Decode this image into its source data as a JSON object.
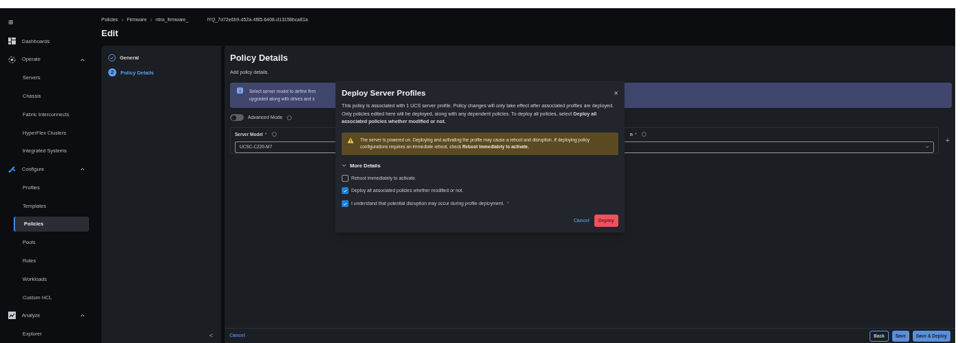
{
  "sidebar": {
    "menu_icon": "≡",
    "items": [
      {
        "kind": "link",
        "label": "Dashboards"
      },
      {
        "kind": "section",
        "label": "Operate",
        "expanded": true,
        "children": [
          {
            "label": "Servers",
            "selected": false
          },
          {
            "label": "Chassis",
            "selected": false
          },
          {
            "label": "Fabric Interconnects",
            "selected": false
          },
          {
            "label": "HyperFlex Clusters",
            "selected": false
          },
          {
            "label": "Integrated Systems",
            "selected": false
          }
        ]
      },
      {
        "kind": "section",
        "label": "Configure",
        "expanded": true,
        "children": [
          {
            "label": "Profiles",
            "selected": false
          },
          {
            "label": "Templates",
            "selected": false
          },
          {
            "label": "Policies",
            "selected": true
          },
          {
            "label": "Pools",
            "selected": false
          },
          {
            "label": "Rules",
            "selected": false
          },
          {
            "label": "Workloads",
            "selected": false
          },
          {
            "label": "Custom HCL",
            "selected": false
          }
        ]
      },
      {
        "kind": "section",
        "label": "Analyze",
        "expanded": true,
        "children": [
          {
            "label": "Explorer",
            "selected": false
          }
        ]
      }
    ]
  },
  "header": {
    "breadcrumbs": [
      "Policies",
      "Firmware",
      "ntnx_firmware_"
    ],
    "separators": [
      "›",
      "›"
    ],
    "id_text": "IYQ_7d72e6b9-d52a-4f85-6408-d13158bca81a",
    "title": "Edit"
  },
  "steps": [
    {
      "label": "General",
      "done": true,
      "selected": false
    },
    {
      "label": "Policy Details",
      "number": "2",
      "done": false,
      "selected": true
    }
  ],
  "collapse": "<",
  "content": {
    "title": "Policy Details",
    "subtitle": "Add policy details.",
    "info_lines": [
      "Select server model to define firm",
      "upgraded along with drives and s"
    ],
    "advanced_mode": {
      "label": "Advanced Mode",
      "on": false
    },
    "server_model": {
      "label": "Server Model",
      "required_mark": "*",
      "value": "UCSC-C220-M7"
    },
    "second_field": {
      "label": "n",
      "required_mark": "*"
    },
    "add": "+"
  },
  "modal": {
    "title": "Deploy Server Profiles",
    "close": "×",
    "body": "This policy is associated with 1 UCS server profile. Policy changes will only take effect after associated profiles are deployed. Only policies edited here will be deployed, along with any dependent policies. To deploy all policies, select **Deploy all associated policies whether modified or not.**",
    "warning": "The server is powered on. Deploying and activating the profile may cause a reboot and disruption. If deploying policy configurations requires an immediate reboot, check **Reboot immediately to activate.**",
    "details": {
      "label": "More Details",
      "expanded": true
    },
    "options": [
      {
        "label": "Reboot immediately to activate.",
        "checked": false
      },
      {
        "label": "Deploy all associated policies whether modified or not.",
        "checked": true
      },
      {
        "label": "I understand that potential disruption may occur during profile deployment.",
        "checked": true,
        "required_mark": "*"
      }
    ],
    "buttons": [
      "Cancel",
      "Deploy"
    ]
  },
  "footer": {
    "cancel": "Cancel",
    "buttons": [
      {
        "label": "Back",
        "kind": "outline"
      },
      {
        "label": "Save",
        "kind": "primary"
      },
      {
        "label": "Save & Deploy",
        "kind": "primary"
      }
    ]
  }
}
